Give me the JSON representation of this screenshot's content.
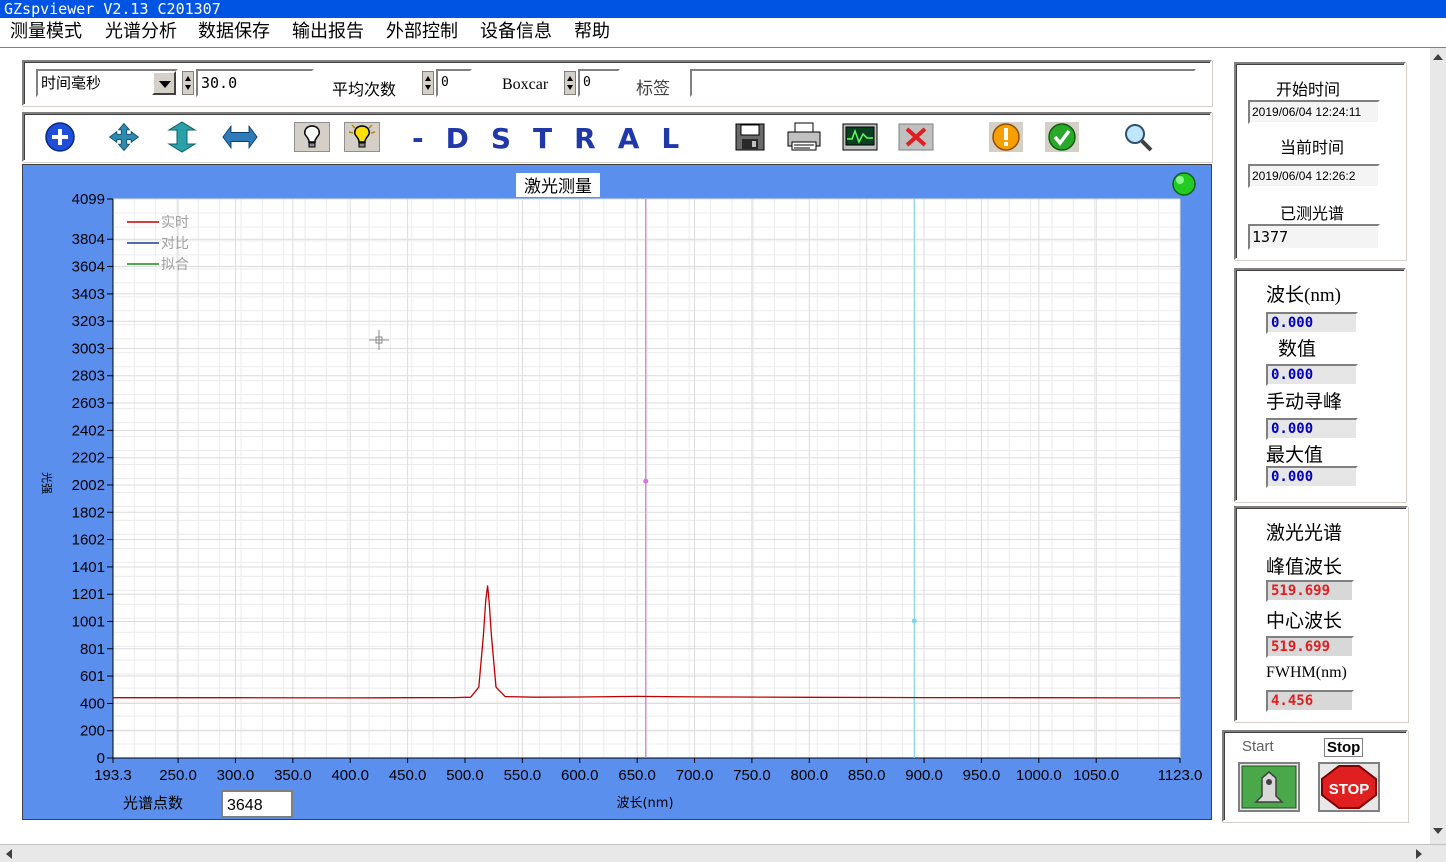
{
  "window": {
    "title": "GZspviewer V2.13 C201307"
  },
  "menu": [
    "测量模式",
    "光谱分析",
    "数据保存",
    "输出报告",
    "外部控制",
    "设备信息",
    "帮助"
  ],
  "settings": {
    "mode_value": "时间毫秒",
    "time_value": "30.0",
    "average_label": "平均次数",
    "average_value": "0",
    "boxcar_label": "Boxcar",
    "boxcar_value": "0",
    "tag_label": "标签",
    "tag_value": ""
  },
  "toolbar": {
    "brand": "-DSTRAL",
    "icons": [
      "zoom-in-icon",
      "pan-icon",
      "vertical-scale-icon",
      "horizontal-scale-icon",
      "bulb-off-icon",
      "bulb-on-icon",
      "save-icon",
      "print-icon",
      "monitor-icon",
      "clear-icon",
      "warning-icon",
      "ok-icon",
      "search-icon"
    ]
  },
  "chart_data": {
    "type": "line",
    "title": "激光测量",
    "xlabel": "波长(nm)",
    "ylabel": "光强",
    "xlim": [
      193.3,
      1123.0
    ],
    "ylim": [
      0,
      4099
    ],
    "x_ticks": [
      "193.3",
      "250.0",
      "300.0",
      "350.0",
      "400.0",
      "450.0",
      "500.0",
      "550.0",
      "600.0",
      "650.0",
      "700.0",
      "750.0",
      "800.0",
      "850.0",
      "900.0",
      "950.0",
      "1000.0",
      "1050.0",
      "1123.0"
    ],
    "y_ticks": [
      "0",
      "200",
      "400",
      "601",
      "801",
      "1001",
      "1201",
      "1401",
      "1602",
      "1802",
      "2002",
      "2202",
      "2402",
      "2603",
      "2803",
      "3003",
      "3203",
      "3403",
      "3604",
      "3804",
      "4099"
    ],
    "grid": true,
    "legend_position": "top-left",
    "legend": [
      {
        "name": "实时",
        "color": "#c00000"
      },
      {
        "name": "对比",
        "color": "#1f3a93"
      },
      {
        "name": "拟合",
        "color": "#1a8a1a"
      }
    ],
    "series": [
      {
        "name": "实时",
        "color": "#c00000",
        "x": [
          193.3,
          300,
          400,
          450,
          490,
          505,
          512,
          516,
          518,
          519.7,
          521,
          523,
          527,
          535,
          560,
          600,
          650,
          700,
          800,
          900,
          1000,
          1123
        ],
        "y": [
          442,
          442,
          441,
          442,
          443,
          446,
          520,
          900,
          1150,
          1265,
          1150,
          900,
          520,
          450,
          446,
          447,
          452,
          448,
          445,
          443,
          442,
          441
        ]
      }
    ],
    "cursors": [
      {
        "x": 657.5,
        "color": "#e070e0",
        "marker_y": 2030
      },
      {
        "x": 891.5,
        "color": "#7fd8e8",
        "marker_y": 1005
      }
    ],
    "point_count_label": "光谱点数",
    "point_count": "3648"
  },
  "status_indicator": {
    "color": "#22cc22"
  },
  "time_panel": {
    "start_label": "开始时间",
    "start_value": "2019/06/04  12:24:11",
    "current_label": "当前时间",
    "current_value": "2019/06/04  12:26:2",
    "measured_label": "已测光谱",
    "measured_value": "1377"
  },
  "readout_panel": {
    "wavelength_label": "波长(nm)",
    "wavelength_value": "0.000",
    "value_label": "数值",
    "value_value": "0.000",
    "peak_search_label": "手动寻峰",
    "peak_search_value": "0.000",
    "max_label": "最大值",
    "max_value": "0.000"
  },
  "laser_panel": {
    "title": "激光光谱",
    "peak_label": "峰值波长",
    "peak_value": "519.699",
    "center_label": "中心波长",
    "center_value": "519.699",
    "fwhm_label": "FWHM(nm)",
    "fwhm_value": "4.456"
  },
  "control_panel": {
    "start_label": "Start",
    "stop_label": "Stop",
    "stop_sign": "STOP"
  }
}
